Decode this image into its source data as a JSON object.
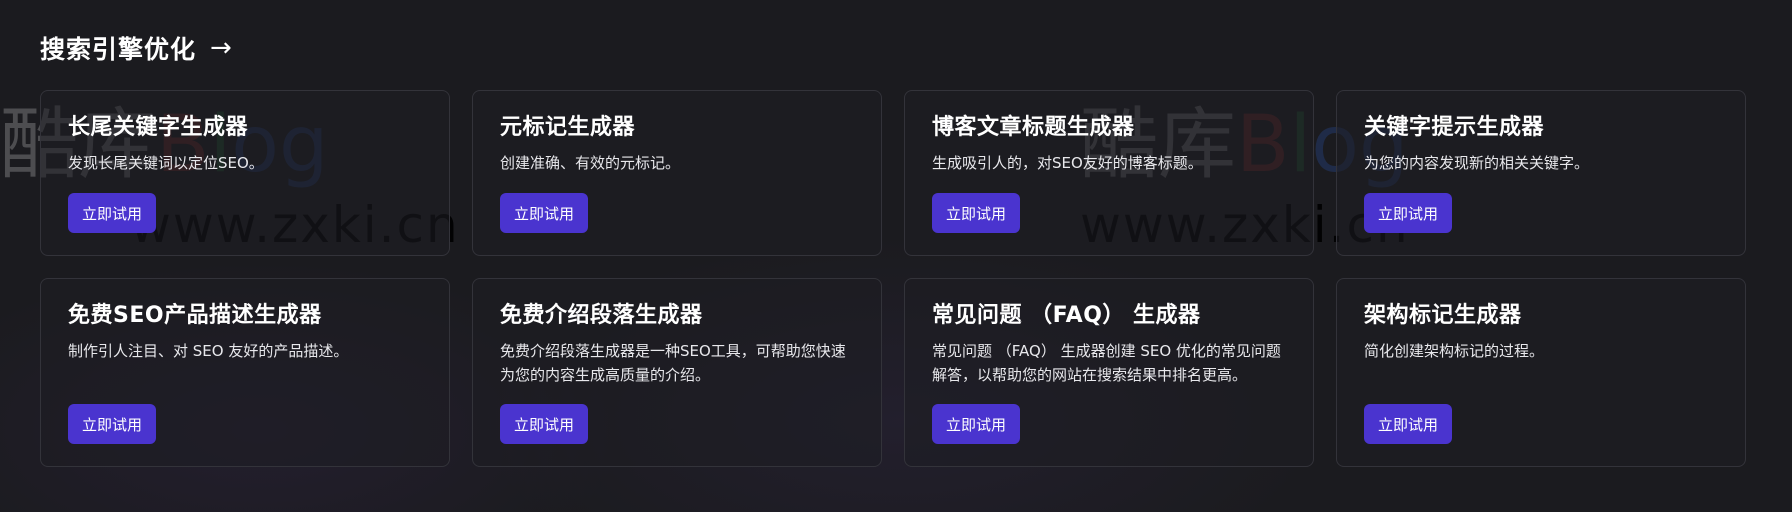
{
  "section": {
    "title": "搜索引擎优化",
    "arrow": "→"
  },
  "cards": [
    {
      "title": "长尾关键字生成器",
      "description": "发现长尾关键词以定位SEO。",
      "button": "立即试用"
    },
    {
      "title": "元标记生成器",
      "description": "创建准确、有效的元标记。",
      "button": "立即试用"
    },
    {
      "title": "博客文章标题生成器",
      "description": "生成吸引人的，对SEO友好的博客标题。",
      "button": "立即试用"
    },
    {
      "title": "关键字提示生成器",
      "description": "为您的内容发现新的相关关键字。",
      "button": "立即试用"
    },
    {
      "title": "免费SEO产品描述生成器",
      "description": "制作引人注目、对 SEO 友好的产品描述。",
      "button": "立即试用"
    },
    {
      "title": "免费介绍段落生成器",
      "description": "免费介绍段落生成器是一种SEO工具，可帮助您快速为您的内容生成高质量的介绍。",
      "button": "立即试用"
    },
    {
      "title": "常见问题 （FAQ） 生成器",
      "description": "常见问题 （FAQ） 生成器创建 SEO 优化的常见问题解答，以帮助您的网站在搜索结果中排名更高。",
      "button": "立即试用"
    },
    {
      "title": "架构标记生成器",
      "description": "简化创建架构标记的过程。",
      "button": "立即试用"
    }
  ],
  "watermark": {
    "logo_left": "酷",
    "logo_char": "库",
    "logo_b": "B",
    "logo_l": "l",
    "logo_o": "o",
    "logo_g": "g",
    "url": "www.zxki.cn"
  },
  "colors": {
    "background": "#1b1b1f",
    "card_border": "#33333a",
    "button": "#4a34cf",
    "text": "#ffffff"
  }
}
